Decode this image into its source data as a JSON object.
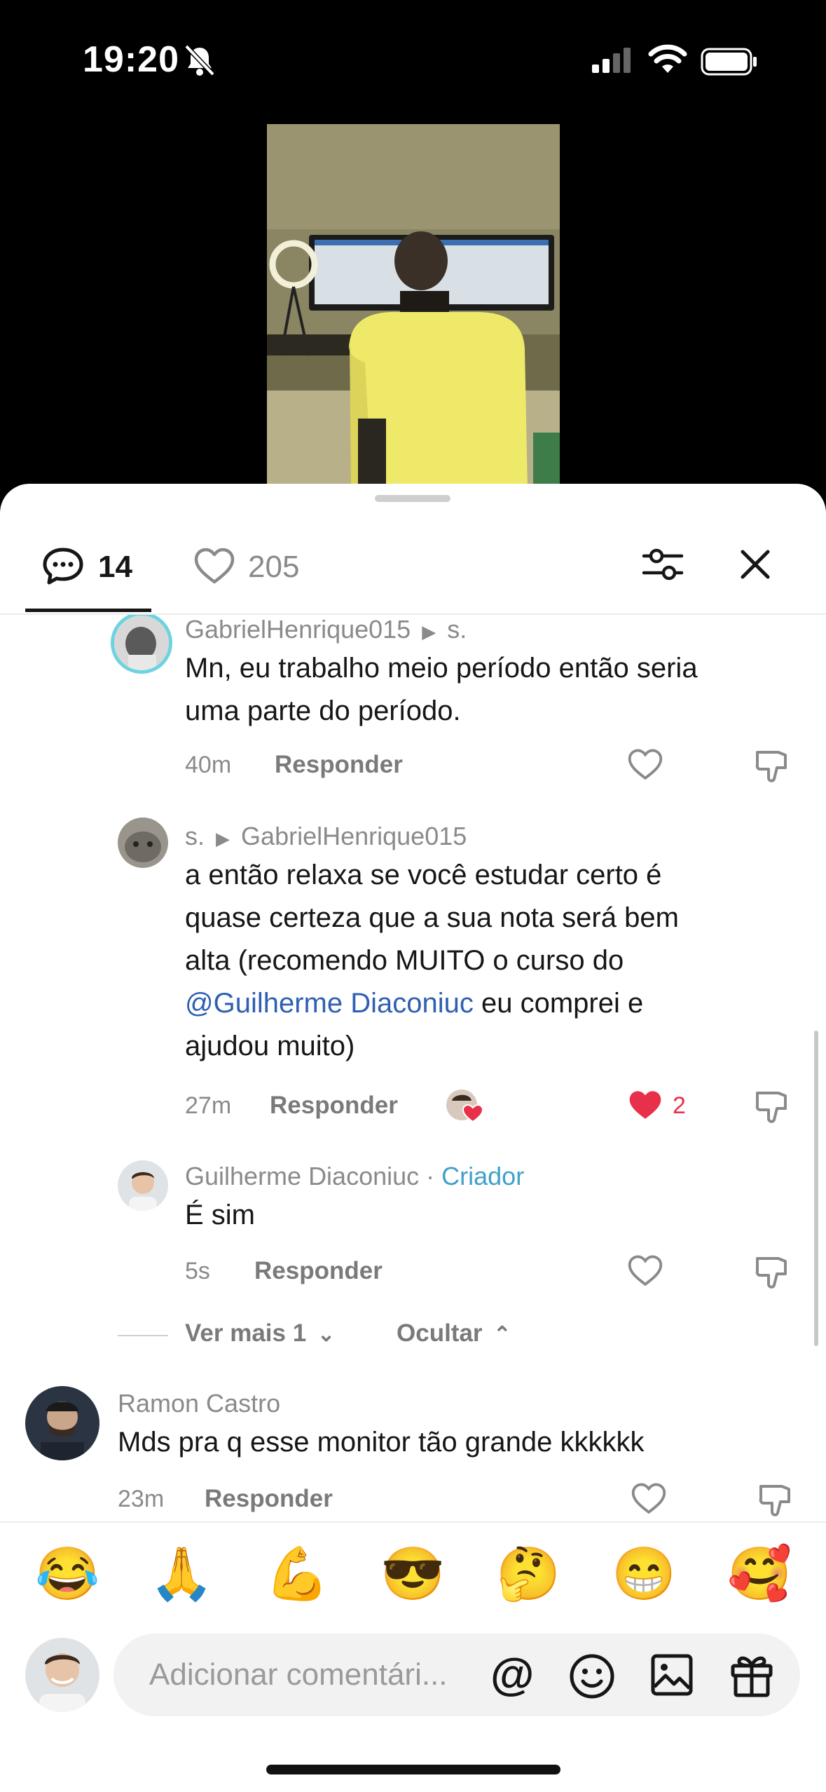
{
  "status_bar": {
    "time": "19:20"
  },
  "tabs": {
    "comments_count": "14",
    "likes_count": "205"
  },
  "comments": [
    {
      "author": "GabrielHenrique015",
      "reply_to": "s.",
      "text_lines": [
        "Mn, eu trabalho meio período então seria",
        "uma parte do período."
      ],
      "time": "40m",
      "reply_label": "Responder"
    },
    {
      "author": "s.",
      "reply_to": "GabrielHenrique015",
      "text_lines": [
        "a então relaxa se você estudar certo é",
        "quase certeza que a sua nota será bem",
        "alta (recomendo MUITO o curso do"
      ],
      "mention": "@Guilherme Diaconiuc",
      "mention_tail": " eu comprei e",
      "last_line": "ajudou muito)",
      "time": "27m",
      "reply_label": "Responder",
      "likes": "2"
    },
    {
      "author": "Guilherme Diaconiuc",
      "separator": " · ",
      "badge": "Criador",
      "text": "É sim",
      "time": "5s",
      "reply_label": "Responder"
    }
  ],
  "thread_controls": {
    "view_more": "Ver mais 1",
    "hide": "Ocultar"
  },
  "top_comment": {
    "author": "Ramon Castro",
    "text": "Mds pra q esse monitor tão grande kkkkkk",
    "time": "23m",
    "reply_label": "Responder"
  },
  "quick_reactions": [
    "😂",
    "🙏",
    "💪",
    "😎",
    "🤔",
    "😁",
    "🥰"
  ],
  "composer": {
    "placeholder": "Adicionar comentári..."
  },
  "colors": {
    "like_active": "#e8304a",
    "creator_badge": "#3fa0c8",
    "mention": "#2f5fb3"
  }
}
